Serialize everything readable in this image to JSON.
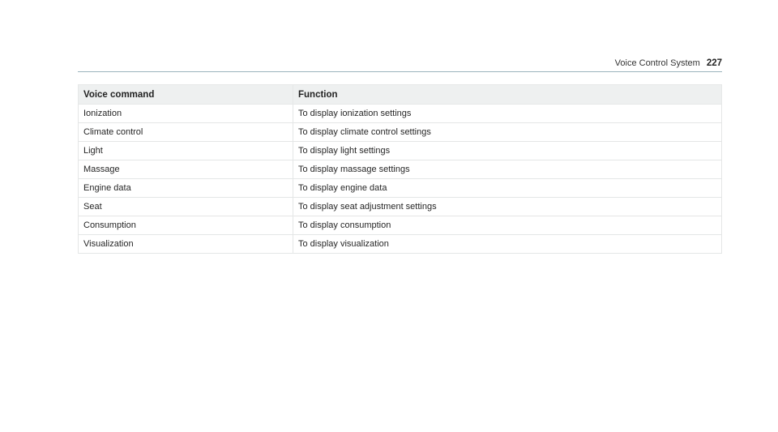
{
  "header": {
    "section_title": "Voice Control System",
    "page_number": "227"
  },
  "table": {
    "columns": [
      "Voice command",
      "Function"
    ],
    "rows": [
      {
        "command": "Ionization",
        "function": "To display ionization settings"
      },
      {
        "command": "Climate control",
        "function": "To display climate control settings"
      },
      {
        "command": "Light",
        "function": "To display light settings"
      },
      {
        "command": "Massage",
        "function": "To display massage settings"
      },
      {
        "command": "Engine data",
        "function": "To display engine data"
      },
      {
        "command": "Seat",
        "function": "To display seat adjustment settings"
      },
      {
        "command": "Consumption",
        "function": "To display consumption"
      },
      {
        "command": "Visualization",
        "function": "To display visualization"
      }
    ]
  }
}
